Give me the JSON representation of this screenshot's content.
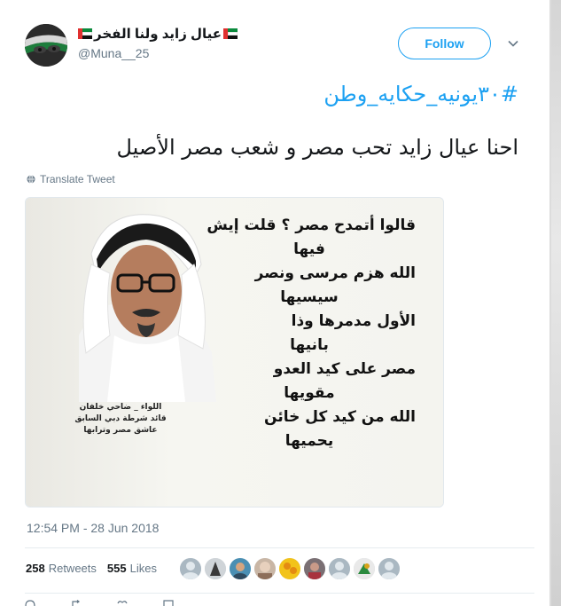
{
  "user": {
    "display_name": "عيال زايد ولنا الفخر",
    "handle": "@Muna__25",
    "flag_icon": "uae-flag-icon"
  },
  "follow": {
    "label": "Follow",
    "color": "#1da1f2"
  },
  "tweet": {
    "hashtag": "#٣٠يونيه_حكايه_وطن",
    "text": "احنا عيال زايد تحب مصر و شعب مصر الأصيل",
    "translate_label": "Translate Tweet"
  },
  "media": {
    "quote_lines": [
      "قالوا أتمدح مصر ؟ قلت إيش",
      "فيها",
      "الله هزم مرسى ونصر",
      "سيسيها",
      "الأول مدمرها وذا",
      "بانيها",
      "مصر على كيد العدو",
      "مقويها",
      "الله من كيد كل خائن",
      "يحميها"
    ],
    "caption_lines": [
      "اللواء _ ضاحي خلفان",
      "قائد شرطة دبي السابق",
      "عاشق مصر وترابها"
    ]
  },
  "meta": {
    "timestamp": "12:54 PM - 28 Jun 2018",
    "retweets_count": "258",
    "retweets_label": "Retweets",
    "likes_count": "555",
    "likes_label": "Likes"
  },
  "likers": [
    "avatar-1",
    "avatar-2",
    "avatar-3",
    "avatar-4",
    "avatar-5",
    "avatar-6",
    "avatar-7",
    "avatar-8",
    "avatar-9"
  ],
  "colors": {
    "accent": "#1da1f2",
    "muted": "#657786",
    "text": "#14171a"
  }
}
